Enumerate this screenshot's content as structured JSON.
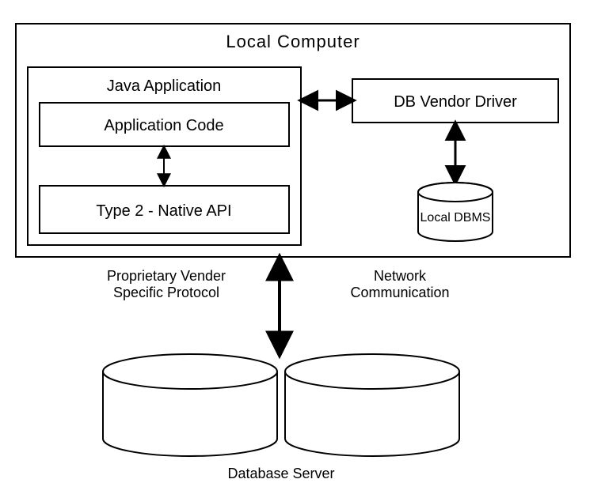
{
  "diagram": {
    "outer_title": "Local  Computer",
    "java_app": {
      "title": "Java Application",
      "app_code": "Application Code",
      "type2": "Type 2 - Native API"
    },
    "db_driver": "DB Vendor Driver",
    "local_dbms": "Local DBMS",
    "protocol_line1": "Proprietary Vender",
    "protocol_line2": "Specific Protocol",
    "network_line1": "Network",
    "network_line2": "Communication",
    "db_server": "Database Server"
  }
}
